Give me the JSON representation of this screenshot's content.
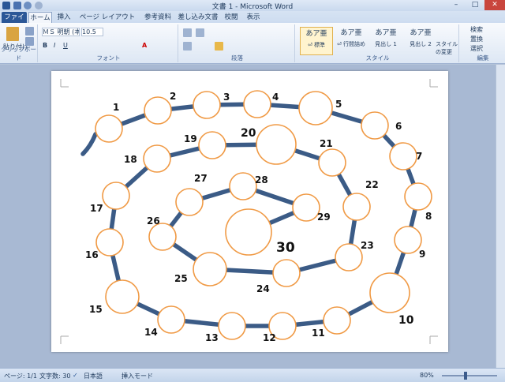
{
  "window": {
    "title": "文書 1 - Microsoft Word",
    "minimize": "–",
    "maximize": "□",
    "close": "✕"
  },
  "tabs": [
    {
      "label": "ファイル"
    },
    {
      "label": "ホーム"
    },
    {
      "label": "挿入"
    },
    {
      "label": "ページ レイアウト"
    },
    {
      "label": "参考資料"
    },
    {
      "label": "差し込み文書"
    },
    {
      "label": "校閲"
    },
    {
      "label": "表示"
    }
  ],
  "ribbon": {
    "clipboard": {
      "paste": "貼り付け",
      "label": "クリップボード"
    },
    "font": {
      "name": "ＭＳ 明朝 (本",
      "size": "10.5",
      "label": "フォント"
    },
    "paragraph": {
      "label": "段落"
    },
    "styles": {
      "label": "スタイル",
      "items": [
        {
          "sample": "あア亜",
          "name": "⏎ 標準"
        },
        {
          "sample": "あア亜",
          "name": "⏎ 行間詰め"
        },
        {
          "sample": "あア亜",
          "name": "見出し 1"
        },
        {
          "sample": "あア亜",
          "name": "見出し 2"
        }
      ],
      "change": "スタイルの変更"
    },
    "editing": {
      "label": "編集",
      "find": "検索",
      "replace": "置換",
      "select": "選択"
    }
  },
  "status": {
    "page": "ページ: 1/1",
    "words": "文字数: 30",
    "language": "日本語",
    "mode": "挿入モード",
    "zoom": "80%"
  },
  "colors": {
    "path": "#3b5b86",
    "circle_stroke": "#f09a45",
    "accent": "#2b5797"
  },
  "maze": {
    "numbers": [
      "1",
      "2",
      "3",
      "4",
      "5",
      "6",
      "7",
      "8",
      "9",
      "10",
      "11",
      "12",
      "13",
      "14",
      "15",
      "16",
      "17",
      "18",
      "19",
      "20",
      "21",
      "22",
      "23",
      "24",
      "25",
      "26",
      "27",
      "28",
      "29",
      "30"
    ]
  }
}
